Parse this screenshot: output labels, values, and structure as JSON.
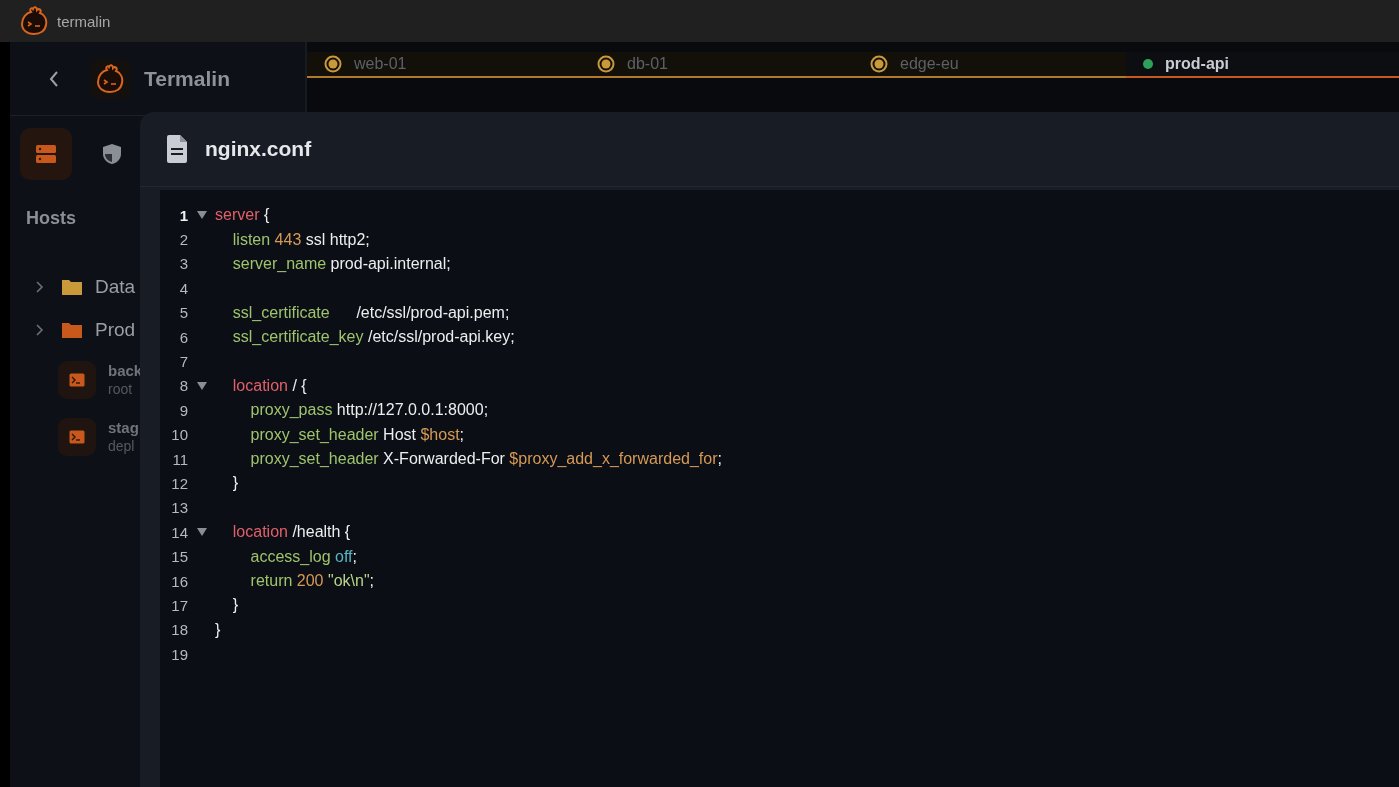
{
  "window": {
    "title": "termalin"
  },
  "sidebar": {
    "app_name": "Termalin",
    "views": [
      {
        "kind": "servers",
        "selected": true
      },
      {
        "kind": "shield",
        "selected": false
      }
    ],
    "section_title": "Hosts",
    "tree": [
      {
        "kind": "folder",
        "label": "Data",
        "color": "#c9993a",
        "expanded": false
      },
      {
        "kind": "folder",
        "label": "Prod",
        "color": "#c8581c",
        "expanded": false
      },
      {
        "kind": "host",
        "label": "back",
        "sublabel": "root"
      },
      {
        "kind": "host",
        "label": "stag",
        "sublabel": "depl"
      }
    ]
  },
  "tabs": [
    {
      "label": "web-01",
      "kind": "connecting",
      "selected": false
    },
    {
      "label": "db-01",
      "kind": "connecting",
      "selected": false
    },
    {
      "label": "edge-eu",
      "kind": "connecting",
      "selected": false
    },
    {
      "label": "prod-api",
      "kind": "online",
      "selected": true
    }
  ],
  "editor": {
    "filename": "nginx.conf",
    "lines": [
      {
        "number": "1",
        "current": true,
        "expanded": true,
        "tokens": [
          {
            "kind": "keyword",
            "text": "server"
          },
          {
            "kind": "plain",
            "text": " {"
          }
        ]
      },
      {
        "number": "2",
        "current": false,
        "tokens": [
          {
            "kind": "directive",
            "text": "    listen "
          },
          {
            "kind": "number",
            "text": "443"
          },
          {
            "kind": "plain",
            "text": " ssl http2;"
          }
        ]
      },
      {
        "number": "3",
        "current": false,
        "tokens": [
          {
            "kind": "directive",
            "text": "    server_name"
          },
          {
            "kind": "plain",
            "text": " prod-api.internal;"
          }
        ]
      },
      {
        "number": "4",
        "current": false
      },
      {
        "number": "5",
        "current": false,
        "tokens": [
          {
            "kind": "directive",
            "text": "    ssl_certificate"
          },
          {
            "kind": "plain",
            "text": "      /etc/ssl/prod-api.pem;"
          }
        ]
      },
      {
        "number": "6",
        "current": false,
        "tokens": [
          {
            "kind": "directive",
            "text": "    ssl_certificate_key"
          },
          {
            "kind": "plain",
            "text": " /etc/ssl/prod-api.key;"
          }
        ]
      },
      {
        "number": "7",
        "current": false
      },
      {
        "number": "8",
        "current": false,
        "expanded": true,
        "tokens": [
          {
            "kind": "keyword",
            "text": "    location"
          },
          {
            "kind": "plain",
            "text": " / {"
          }
        ]
      },
      {
        "number": "9",
        "current": false,
        "tokens": [
          {
            "kind": "directive",
            "text": "        proxy_pass"
          },
          {
            "kind": "plain",
            "text": " http://127.0.0.1:8000;"
          }
        ]
      },
      {
        "number": "10",
        "current": false,
        "tokens": [
          {
            "kind": "directive",
            "text": "        proxy_set_header"
          },
          {
            "kind": "plain",
            "text": " Host "
          },
          {
            "kind": "variable",
            "text": "$host"
          },
          {
            "kind": "plain",
            "text": ";"
          }
        ]
      },
      {
        "number": "11",
        "current": false,
        "tokens": [
          {
            "kind": "directive",
            "text": "        proxy_set_header"
          },
          {
            "kind": "plain",
            "text": " X-Forwarded-For "
          },
          {
            "kind": "variable",
            "text": "$proxy_add_x_forwarded_for"
          },
          {
            "kind": "plain",
            "text": ";"
          }
        ]
      },
      {
        "number": "12",
        "current": false,
        "tokens": [
          {
            "kind": "plain",
            "text": "    }"
          }
        ]
      },
      {
        "number": "13",
        "current": false
      },
      {
        "number": "14",
        "current": false,
        "expanded": true,
        "tokens": [
          {
            "kind": "keyword",
            "text": "    location"
          },
          {
            "kind": "plain",
            "text": " /health {"
          }
        ]
      },
      {
        "number": "15",
        "current": false,
        "tokens": [
          {
            "kind": "directive",
            "text": "        access_log "
          },
          {
            "kind": "constant",
            "text": "off"
          },
          {
            "kind": "plain",
            "text": ";"
          }
        ]
      },
      {
        "number": "16",
        "current": false,
        "tokens": [
          {
            "kind": "directive",
            "text": "        return "
          },
          {
            "kind": "number",
            "text": "200"
          },
          {
            "kind": "string",
            "text": " \"ok\\n\""
          },
          {
            "kind": "plain",
            "text": ";"
          }
        ]
      },
      {
        "number": "17",
        "current": false,
        "tokens": [
          {
            "kind": "plain",
            "text": "    }"
          }
        ]
      },
      {
        "number": "18",
        "current": false,
        "tokens": [
          {
            "kind": "plain",
            "text": "}"
          }
        ]
      },
      {
        "number": "19",
        "current": false
      }
    ]
  }
}
